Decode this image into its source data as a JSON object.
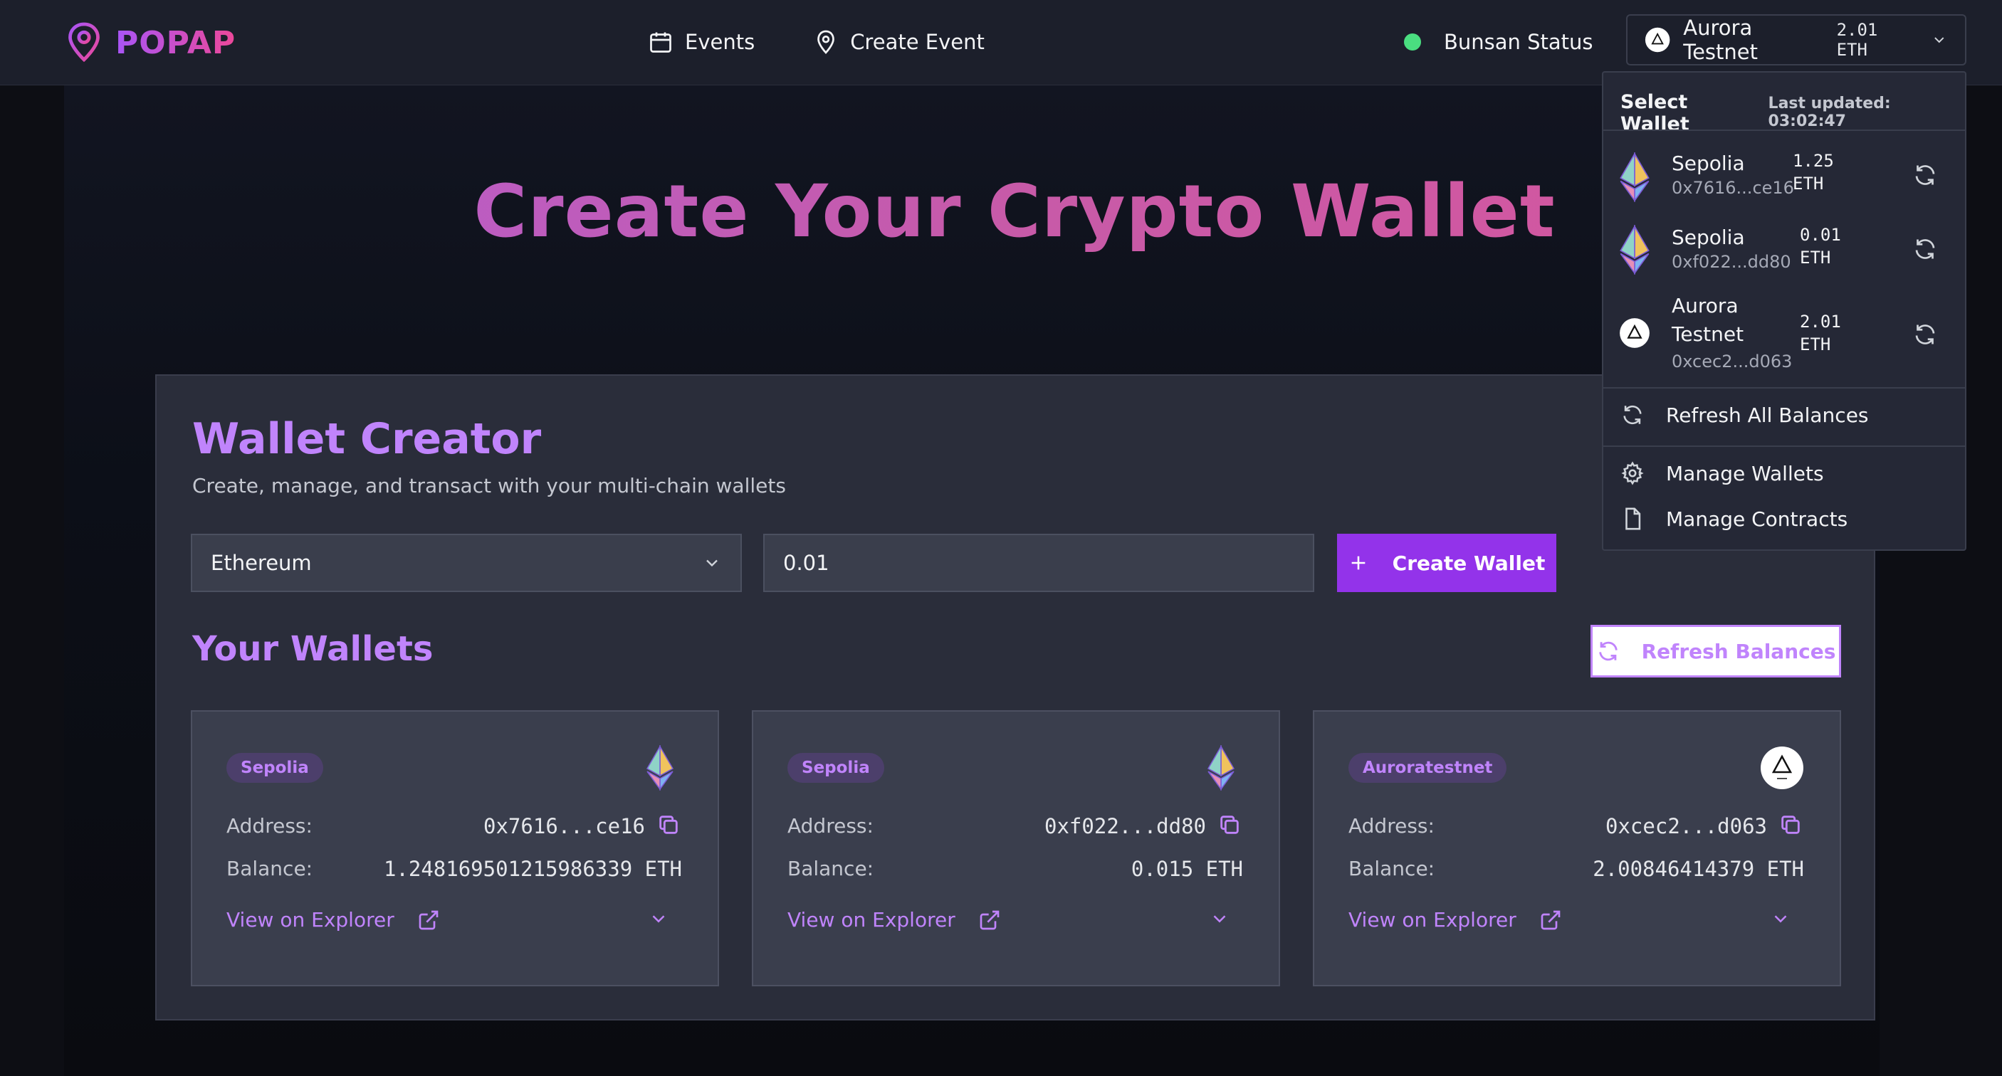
{
  "header": {
    "logo_text": "POPAP",
    "nav": [
      {
        "label": "Events",
        "icon": "calendar-icon"
      },
      {
        "label": "Create Event",
        "icon": "map-pin-icon"
      }
    ],
    "status_label": "Bunsan Status",
    "status_color": "#4ade80",
    "network": {
      "name": "Aurora Testnet",
      "balance": "2.01 ETH"
    }
  },
  "page_title": "Create Your Crypto Wallet",
  "panel": {
    "title": "Wallet Creator",
    "subtitle": "Create, manage, and transact with your multi-chain wallets",
    "chain_select": "Ethereum",
    "amount_value": "0.01",
    "create_label": "Create Wallet",
    "wallets_title": "Your Wallets",
    "refresh_label": "Refresh Balances"
  },
  "wallets": [
    {
      "badge": "Sepolia",
      "address_label": "Address:",
      "address": "0x7616...ce16",
      "balance_label": "Balance:",
      "balance": "1.248169501215986339 ETH",
      "explorer": "View on Explorer",
      "logo": "ethereum-icon"
    },
    {
      "badge": "Sepolia",
      "address_label": "Address:",
      "address": "0xf022...dd80",
      "balance_label": "Balance:",
      "balance": "0.015 ETH",
      "explorer": "View on Explorer",
      "logo": "ethereum-icon"
    },
    {
      "badge": "Auroratestnet",
      "address_label": "Address:",
      "address": "0xcec2...d063",
      "balance_label": "Balance:",
      "balance": "2.00846414379 ETH",
      "explorer": "View on Explorer",
      "logo": "aurora-icon"
    }
  ],
  "dropdown": {
    "title": "Select Wallet",
    "updated": "Last updated: 03:02:47",
    "wallets": [
      {
        "name": "Sepolia",
        "address": "0x7616...ce16",
        "amount": "1.25",
        "unit": "ETH"
      },
      {
        "name": "Sepolia",
        "address": "0xf022...dd80",
        "amount": "0.01",
        "unit": "ETH"
      },
      {
        "name_line1": "Aurora",
        "name_line2": "Testnet",
        "address": "0xcec2...d063",
        "amount": "2.01",
        "unit": "ETH"
      }
    ],
    "refresh_all": "Refresh All Balances",
    "manage_wallets": "Manage Wallets",
    "manage_contracts": "Manage Contracts"
  },
  "colors": {
    "accent": "#c084fc",
    "button": "#9333ea"
  }
}
